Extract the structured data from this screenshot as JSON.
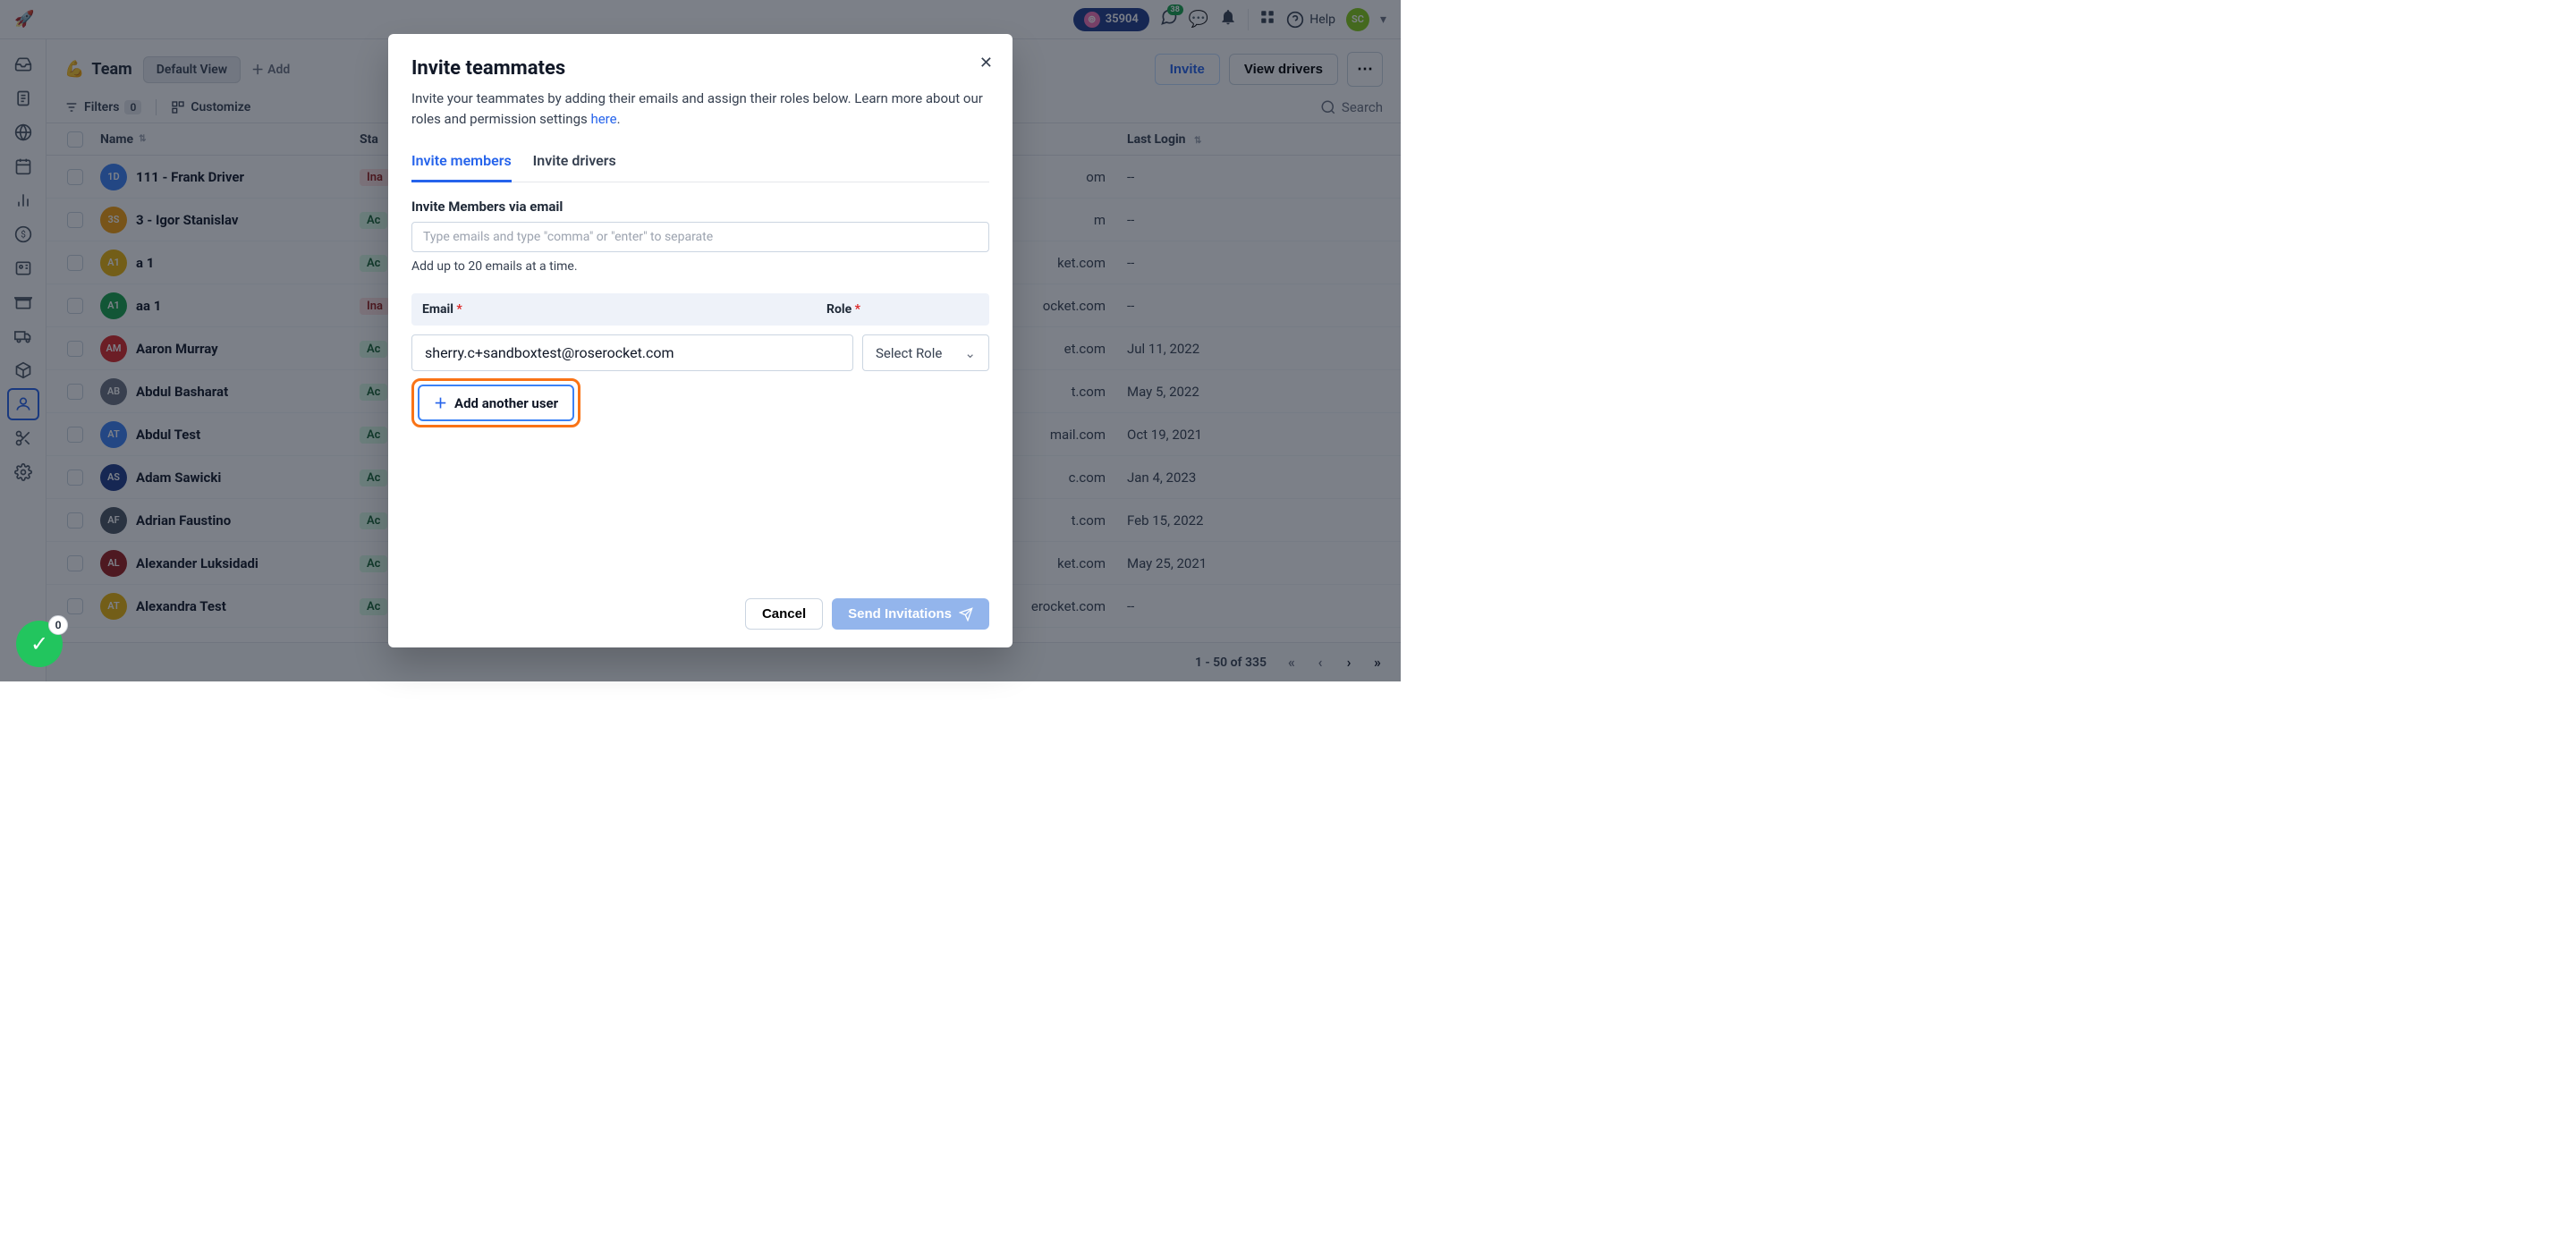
{
  "topbar": {
    "credits": "35904",
    "notif_badge": "38",
    "help_label": "Help",
    "avatar": "SC"
  },
  "page": {
    "emoji": "💪",
    "title_text": "Team",
    "default_view": "Default View",
    "add_label": "Add",
    "invite_label": "Invite",
    "view_drivers_label": "View drivers"
  },
  "toolbar": {
    "filters_label": "Filters",
    "filters_count": "0",
    "customize_label": "Customize",
    "search_label": "Search"
  },
  "table": {
    "headers": {
      "name": "Name",
      "status": "Sta",
      "last_login": "Last Login"
    },
    "rows": [
      {
        "initials": "1D",
        "color": "#3b82f6",
        "name": "111 - Frank Driver",
        "status": "Ina",
        "emailTail": "om",
        "login": "--"
      },
      {
        "initials": "3S",
        "color": "#f59e0b",
        "name": "3 - Igor Stanislav",
        "status": "Ac",
        "emailTail": "m",
        "login": "--"
      },
      {
        "initials": "A1",
        "color": "#eab308",
        "name": "a 1",
        "status": "Ac",
        "emailTail": "ket.com",
        "login": "--"
      },
      {
        "initials": "A1",
        "color": "#16a34a",
        "name": "aa 1",
        "status": "Ina",
        "emailTail": "ocket.com",
        "login": "--"
      },
      {
        "initials": "AM",
        "color": "#dc2626",
        "name": "Aaron Murray",
        "status": "Ac",
        "emailTail": "et.com",
        "login": "Jul 11, 2022"
      },
      {
        "initials": "AB",
        "color": "#6b7280",
        "name": "Abdul Basharat",
        "status": "Ac",
        "emailTail": "t.com",
        "login": "May 5, 2022"
      },
      {
        "initials": "AT",
        "color": "#3b82f6",
        "name": "Abdul Test",
        "status": "Ac",
        "emailTail": "mail.com",
        "login": "Oct 19, 2021"
      },
      {
        "initials": "AS",
        "color": "#1e3a8a",
        "name": "Adam Sawicki",
        "status": "Ac",
        "emailTail": "c.com",
        "login": "Jan 4, 2023"
      },
      {
        "initials": "AF",
        "color": "#4b5563",
        "name": "Adrian Faustino",
        "status": "Ac",
        "emailTail": "t.com",
        "login": "Feb 15, 2022"
      },
      {
        "initials": "AL",
        "color": "#991b1b",
        "name": "Alexander Luksidadi",
        "status": "Ac",
        "emailTail": "ket.com",
        "login": "May 25, 2021"
      },
      {
        "initials": "AT",
        "color": "#eab308",
        "name": "Alexandra Test",
        "status": "Ac",
        "emailTail": "erocket.com",
        "login": "--"
      }
    ]
  },
  "pagination": {
    "text": "1 - 50 of 335"
  },
  "modal": {
    "title": "Invite teammates",
    "desc1": "Invite your teammates by adding their emails and assign their roles below. Learn more about our roles and permission settings ",
    "desc_link": "here",
    "tab_members": "Invite members",
    "tab_drivers": "Invite drivers",
    "section_label": "Invite Members via email",
    "email_placeholder": "Type emails and type \"comma\" or \"enter\" to separate",
    "hint": "Add up to 20 emails at a time.",
    "col_email": "Email",
    "col_role": "Role",
    "email_value": "sherry.c+sandboxtest@roserocket.com",
    "role_placeholder": "Select Role",
    "add_another": "Add another user",
    "cancel": "Cancel",
    "send": "Send Invitations"
  },
  "success": {
    "count": "0"
  }
}
